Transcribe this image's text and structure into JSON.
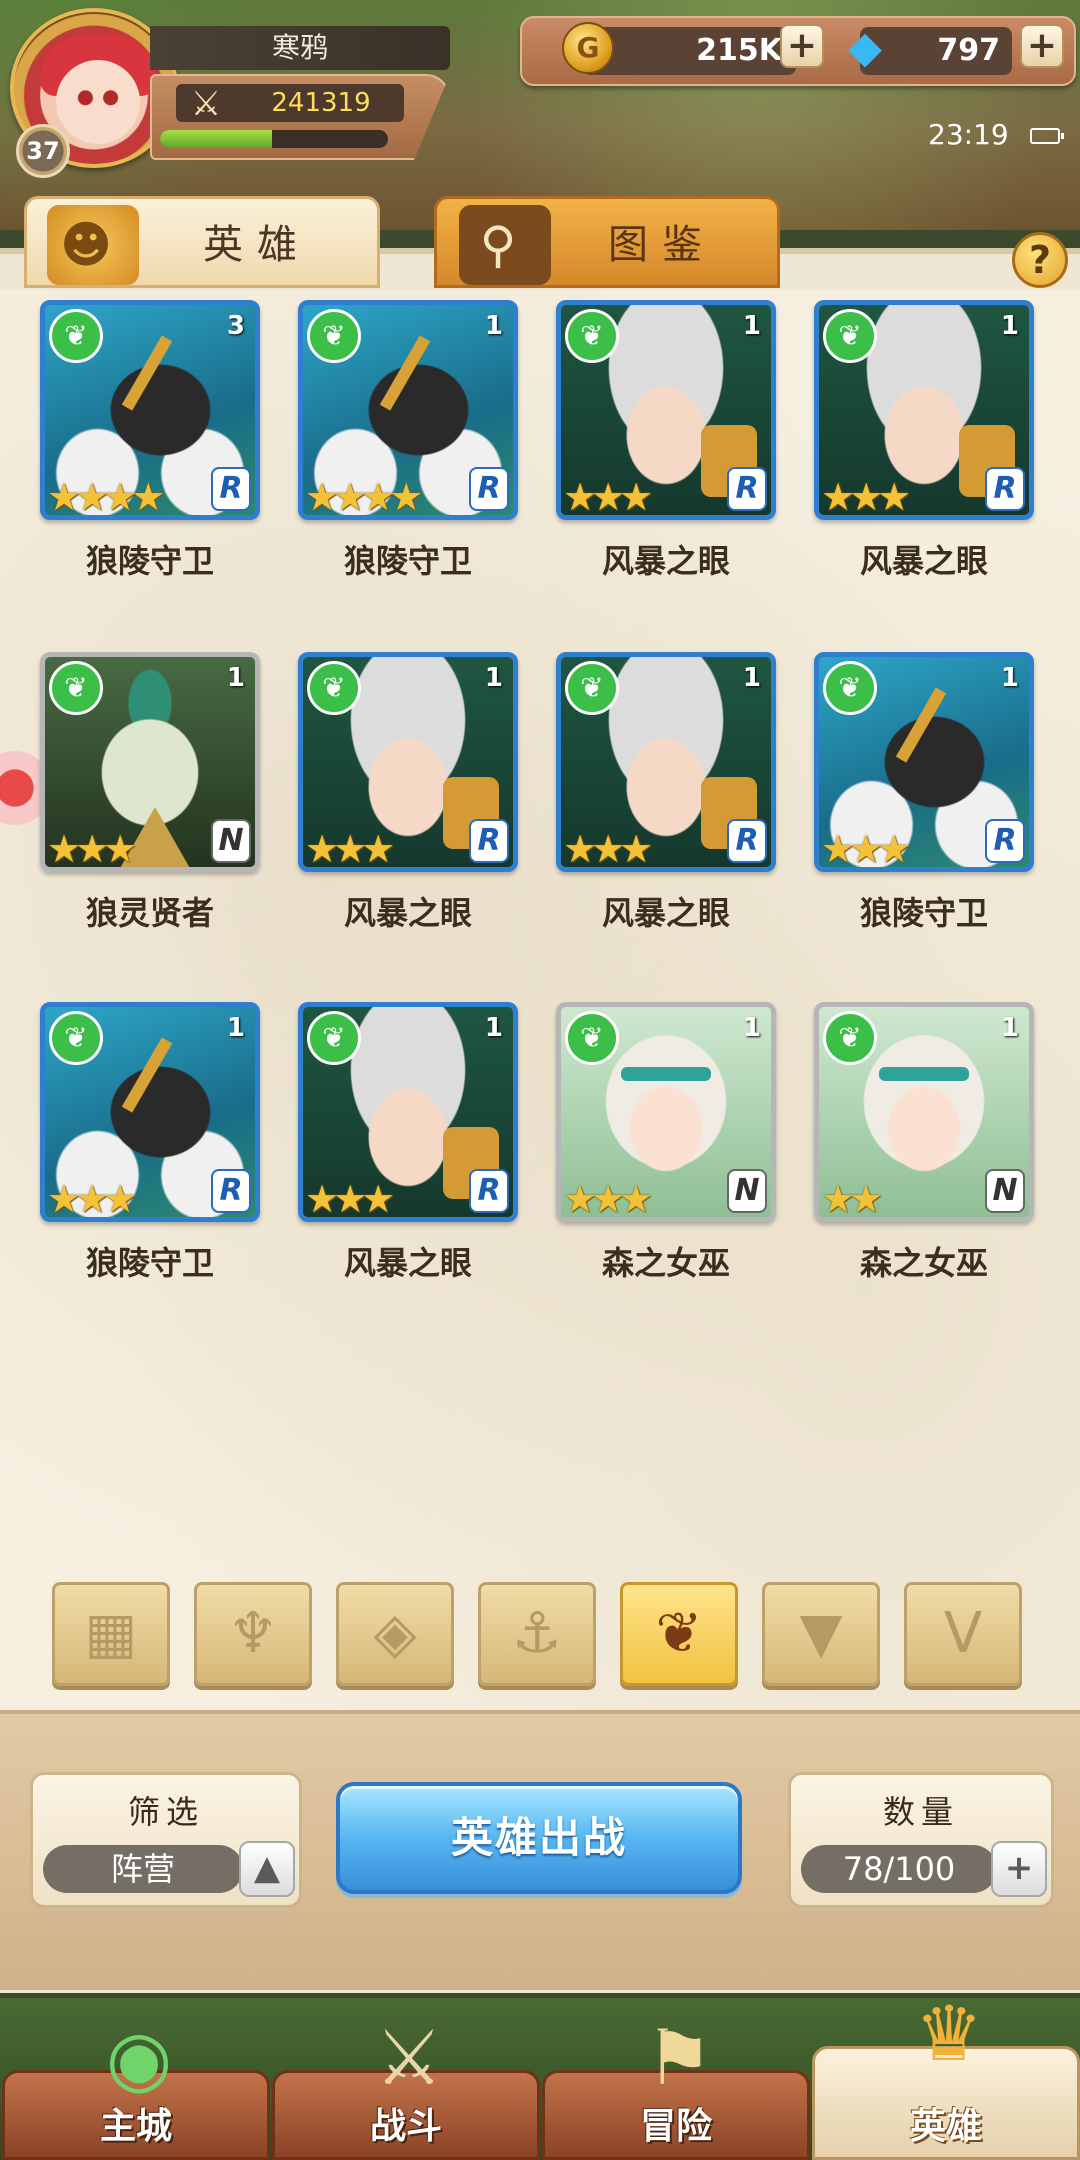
{
  "player": {
    "name": "寒鸦",
    "level": "37",
    "power": "241319",
    "exp_fraction": 0.49
  },
  "currency": {
    "gold": "215K",
    "gems": "797",
    "plus": "+"
  },
  "status": {
    "time": "23:19"
  },
  "tabs": [
    {
      "label": "英雄",
      "icon": "helmet-icon"
    },
    {
      "label": "图鉴",
      "icon": "magnifier-icon"
    }
  ],
  "help_label": "?",
  "heroes": [
    {
      "name": "狼陵守卫",
      "count": "3",
      "rank": "R",
      "stars": 4,
      "portrait": "wolf"
    },
    {
      "name": "狼陵守卫",
      "count": "1",
      "rank": "R",
      "stars": 4,
      "portrait": "wolf"
    },
    {
      "name": "风暴之眼",
      "count": "1",
      "rank": "R",
      "stars": 3,
      "portrait": "storm"
    },
    {
      "name": "风暴之眼",
      "count": "1",
      "rank": "R",
      "stars": 3,
      "portrait": "storm"
    },
    {
      "name": "狼灵贤者",
      "count": "1",
      "rank": "N",
      "stars": 3,
      "portrait": "sage"
    },
    {
      "name": "风暴之眼",
      "count": "1",
      "rank": "R",
      "stars": 3,
      "portrait": "storm"
    },
    {
      "name": "风暴之眼",
      "count": "1",
      "rank": "R",
      "stars": 3,
      "portrait": "storm"
    },
    {
      "name": "狼陵守卫",
      "count": "1",
      "rank": "R",
      "stars": 3,
      "portrait": "wolf"
    },
    {
      "name": "狼陵守卫",
      "count": "1",
      "rank": "R",
      "stars": 3,
      "portrait": "wolf"
    },
    {
      "name": "风暴之眼",
      "count": "1",
      "rank": "R",
      "stars": 3,
      "portrait": "storm"
    },
    {
      "name": "森之女巫",
      "count": "1",
      "rank": "N",
      "stars": 3,
      "portrait": "witch"
    },
    {
      "name": "森之女巫",
      "count": "1",
      "rank": "N",
      "stars": 2,
      "portrait": "witch"
    }
  ],
  "filters": [
    {
      "icon": "grid-icon",
      "glyph": "▦",
      "active": false
    },
    {
      "icon": "leaf-icon",
      "glyph": "♆",
      "active": false
    },
    {
      "icon": "diamond-icon",
      "glyph": "◈",
      "active": false
    },
    {
      "icon": "anchor-icon",
      "glyph": "⚓",
      "active": false
    },
    {
      "icon": "wolf-icon",
      "glyph": "❦",
      "active": true
    },
    {
      "icon": "demon-icon",
      "glyph": "▼",
      "active": false
    },
    {
      "icon": "wing-icon",
      "glyph": "V",
      "active": false
    }
  ],
  "controls": {
    "filter_title": "筛选",
    "filter_value": "阵营",
    "deploy_label": "英雄出战",
    "count_title": "数量",
    "count_value": "78/100"
  },
  "nav": [
    {
      "label": "主城",
      "icon": "city-icon",
      "active": false
    },
    {
      "label": "战斗",
      "icon": "swords-icon",
      "active": false
    },
    {
      "label": "冒险",
      "icon": "scroll-icon",
      "active": false
    },
    {
      "label": "英雄",
      "icon": "hero-icon",
      "active": true
    }
  ]
}
